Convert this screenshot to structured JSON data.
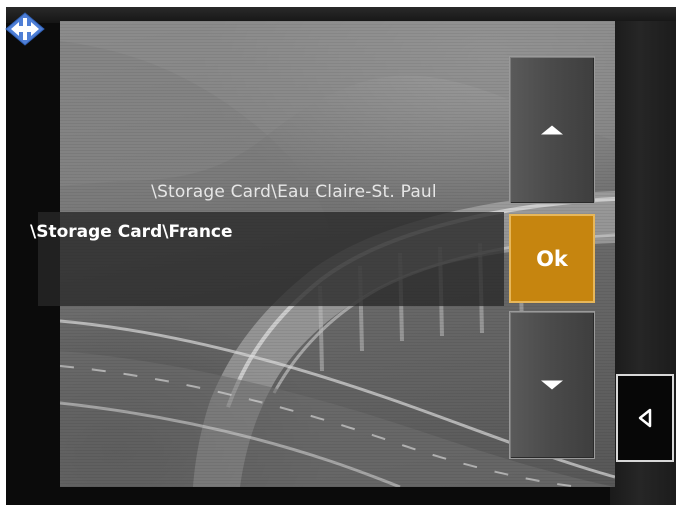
{
  "app": {
    "logo_icon": "navigation-diamond-logo-icon"
  },
  "list": {
    "previous_item": "\\Storage Card\\Eau Claire-St. Paul",
    "selected_item": "\\Storage Card\\France"
  },
  "buttons": {
    "scroll_up_icon": "triangle-up-icon",
    "ok_label": "Ok",
    "scroll_down_icon": "triangle-down-icon",
    "back_icon": "triangle-left-icon"
  },
  "colors": {
    "ok_button": "#c6850f",
    "logo_blue": "#4f7fd6",
    "selection_band": "#282828"
  }
}
